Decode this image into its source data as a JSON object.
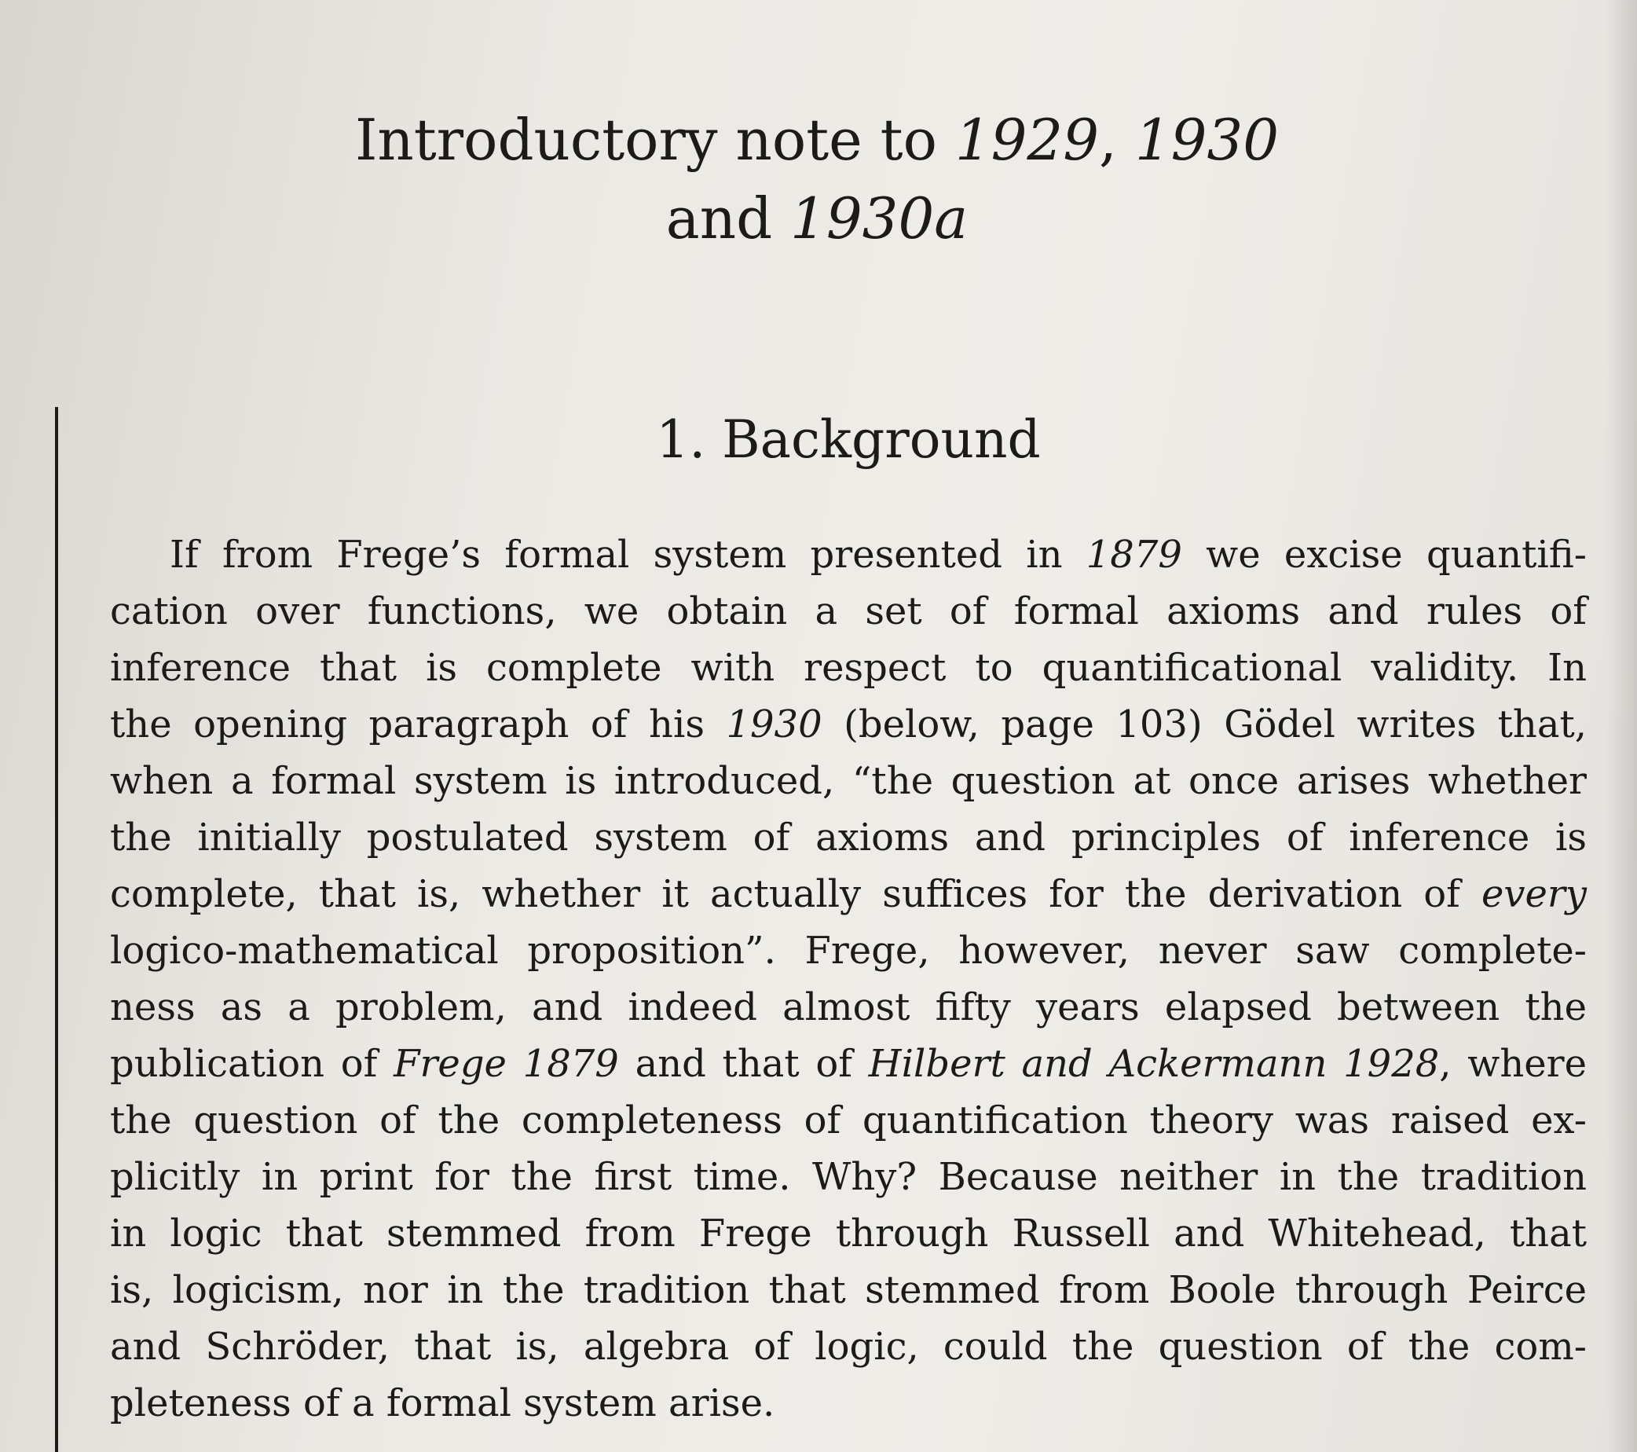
{
  "title": {
    "line1_prefix": "Introductory note to ",
    "line1_ref1": "1929",
    "line1_sep": ", ",
    "line1_ref2": "1930",
    "line2_prefix": "and ",
    "line2_ref": "1930a"
  },
  "section": {
    "heading": "1. Background"
  },
  "body": {
    "l1a": "If from Frege’s formal system presented in ",
    "l1b": "1879",
    "l1c": " we excise quantifi-",
    "l2": "cation over functions, we obtain a set of formal axioms and rules of",
    "l3": "inference that is complete with respect to quantificational validity. In",
    "l4a": "the opening paragraph of his ",
    "l4b": "1930",
    "l4c": " (below, page 103) Gödel writes that,",
    "l5": "when a formal system is introduced, “the question at once arises whether",
    "l6": "the initially postulated system of axioms and principles of inference is",
    "l7a": "complete, that is, whether it actually suffices for the derivation of ",
    "l7b": "every",
    "l8": "logico-mathematical proposition”. Frege, however, never saw complete-",
    "l9": "ness as a problem, and indeed almost fifty years elapsed between the",
    "l10a": "publication of ",
    "l10b": "Frege 1879",
    "l10c": " and that of ",
    "l10d": "Hilbert and Ackermann 1928",
    "l10e": ", where",
    "l11": "the question of the completeness of quantification theory was raised ex-",
    "l12": "plicitly in print for the first time. Why? Because neither in the tradition",
    "l13": "in logic that stemmed from Frege through Russell and Whitehead, that",
    "l14": "is, logicism, nor in the tradition that stemmed from Boole through Peirce",
    "l15": "and Schröder, that is, algebra of logic, could the question of the com-",
    "l16": "pleteness of a formal system arise."
  }
}
